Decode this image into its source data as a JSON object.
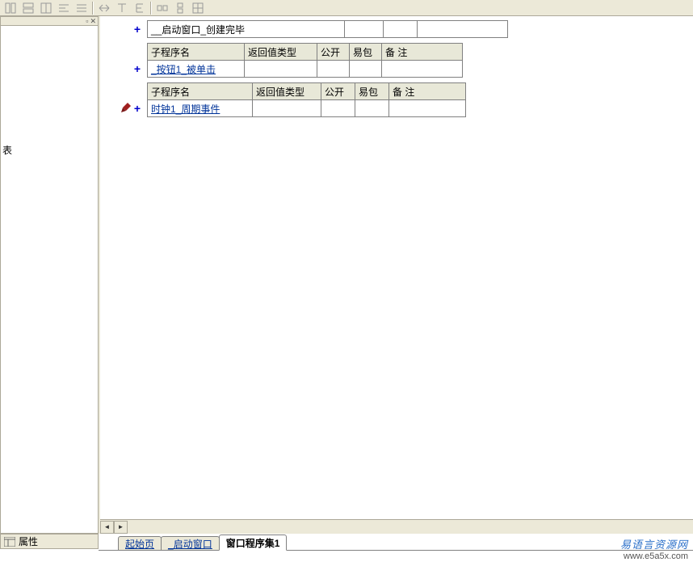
{
  "toolbar": {
    "icons": [
      "layout-1",
      "layout-2",
      "layout-3",
      "align-h",
      "align-just",
      "arrow-lr",
      "tool-t",
      "tool-e",
      "sep",
      "box-lr",
      "box-ud",
      "grid"
    ]
  },
  "left_panel": {
    "stub": "表"
  },
  "rows": [
    {
      "type": "value_only",
      "name": "__启动窗口_创建完毕"
    },
    {
      "type": "full",
      "headers": {
        "name": "子程序名",
        "ret": "返回值类型",
        "pub": "公开",
        "pkg": "易包",
        "note": "备 注"
      },
      "name": "_按钮1_被单击"
    },
    {
      "type": "full_cursor",
      "headers": {
        "name": "子程序名",
        "ret": "返回值类型",
        "pub": "公开",
        "pkg": "易包",
        "note": "备 注"
      },
      "name": "时钟1_周期事件"
    }
  ],
  "tabs": {
    "items": [
      {
        "label": "起始页",
        "active": false
      },
      {
        "label": "_启动窗口",
        "active": false
      },
      {
        "label": "窗口程序集1",
        "active": true
      }
    ]
  },
  "properties_button": "属性",
  "watermark": {
    "cn": "易语言资源网",
    "en": "www.e5a5x.com"
  }
}
